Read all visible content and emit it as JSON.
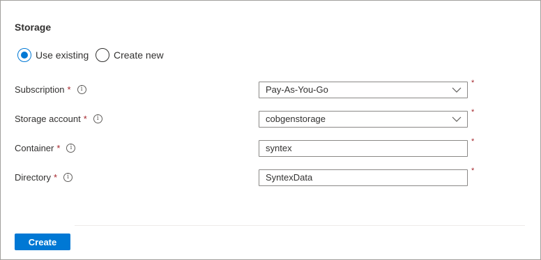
{
  "section": {
    "title": "Storage"
  },
  "radios": {
    "use_existing": {
      "label": "Use existing",
      "selected": true
    },
    "create_new": {
      "label": "Create new",
      "selected": false
    }
  },
  "fields": {
    "subscription": {
      "label": "Subscription",
      "required": "*",
      "value": "Pay-As-You-Go",
      "type": "dropdown",
      "icon": "info-icon"
    },
    "storage_account": {
      "label": "Storage account",
      "required": "*",
      "value": "cobgenstorage",
      "type": "dropdown",
      "icon": "info-icon"
    },
    "container": {
      "label": "Container",
      "required": "*",
      "value": "syntex",
      "type": "text",
      "icon": "info-icon"
    },
    "directory": {
      "label": "Directory",
      "required": "*",
      "value": "SyntexData",
      "type": "text",
      "icon": "info-icon"
    }
  },
  "info_glyph": "i",
  "actions": {
    "create_label": "Create"
  },
  "colors": {
    "accent": "#0078d4",
    "required": "#a4262c",
    "border": "#8a8886"
  }
}
